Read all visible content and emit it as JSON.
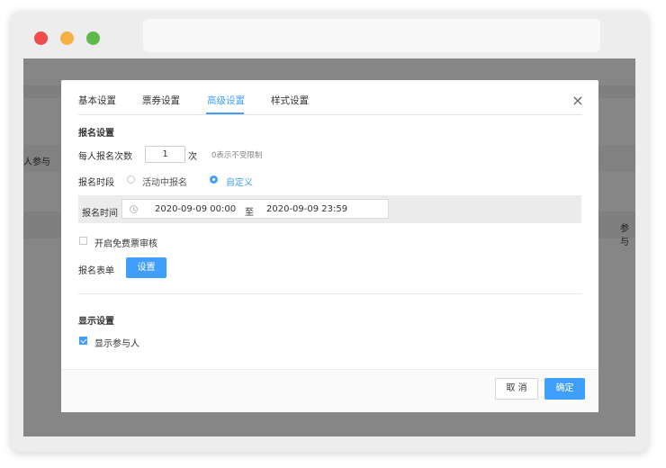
{
  "background": {
    "left_label_1": "人参与",
    "right_label_1": "参与"
  },
  "tabs": [
    {
      "label": "基本设置"
    },
    {
      "label": "票券设置"
    },
    {
      "label": "高级设置"
    },
    {
      "label": "样式设置"
    }
  ],
  "active_tab": "高级设置",
  "close_symbol": "×",
  "signup": {
    "section_title": "报名设置",
    "count_label": "每人报名次数",
    "count_value": "1",
    "count_unit": "次",
    "count_hint": "0表示不受限制",
    "period_label": "报名时段",
    "period_options": [
      {
        "label": "活动中报名",
        "checked": false
      },
      {
        "label": "自定义",
        "checked": true
      }
    ],
    "time_label": "报名时间",
    "start_time": "2020-09-09 00:00",
    "range_separator": "至",
    "end_time": "2020-09-09 23:59",
    "free_review_label": "开启免费票审核",
    "free_review_checked": false,
    "form_label": "报名表单",
    "form_button": "设置"
  },
  "display": {
    "section_title": "显示设置",
    "show_participants_label": "显示参与人",
    "show_participants_checked": true
  },
  "footer": {
    "cancel_label": "取 消",
    "confirm_label": "确定"
  },
  "colors": {
    "accent": "#409eff",
    "overlay": "rgba(0,0,0,0.45)"
  }
}
